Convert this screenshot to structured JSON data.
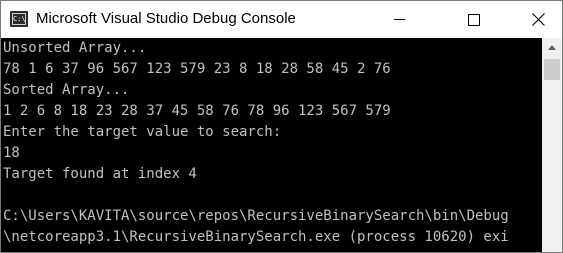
{
  "window": {
    "title": "Microsoft Visual Studio Debug Console",
    "icon": "console-app-icon",
    "icon_label": "C:\\"
  },
  "console": {
    "lines": [
      "Unsorted Array...",
      "78 1 6 37 96 567 123 579 23 8 18 28 58 45 2 76",
      "Sorted Array...",
      "1 2 6 8 18 23 28 37 45 58 76 78 96 123 567 579",
      "Enter the target value to search:",
      "18",
      "Target found at index 4",
      "",
      "C:\\Users\\KAVITA\\source\\repos\\RecursiveBinarySearch\\bin\\Debug",
      "\\netcoreapp3.1\\RecursiveBinarySearch.exe (process 10620) exi"
    ]
  },
  "colors": {
    "console_bg": "#000000",
    "console_text": "#c0c0c0",
    "titlebar_bg": "#ffffff",
    "scrollbar_bg": "#f0f0f0",
    "scrollbar_thumb": "#cdcdcd"
  }
}
